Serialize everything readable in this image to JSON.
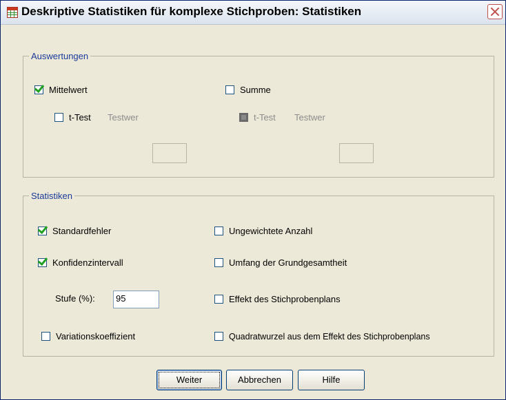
{
  "window": {
    "title": "Deskriptive Statistiken für komplexe Stichproben: Statistiken"
  },
  "auswertungen": {
    "legend": "Auswertungen",
    "mittelwert": {
      "label": "Mittelwert",
      "checked": true
    },
    "mittelwert_ttest": {
      "label": "t-Test",
      "checked": false,
      "testwert_label": "Testwer",
      "testwert_value": ""
    },
    "summe": {
      "label": "Summe",
      "checked": false
    },
    "summe_ttest": {
      "label": "t-Test",
      "checked": false,
      "disabled": true,
      "testwert_label": "Testwer",
      "testwert_value": ""
    }
  },
  "statistiken": {
    "legend": "Statistiken",
    "standardfehler": {
      "label": "Standardfehler",
      "checked": true
    },
    "konfidenzintervall": {
      "label": "Konfidenzintervall",
      "checked": true
    },
    "stufe": {
      "label": "Stufe (%):",
      "value": "95"
    },
    "variationskoeffizient": {
      "label": "Variationskoeffizient",
      "checked": false
    },
    "ungewichtete_anzahl": {
      "label": "Ungewichtete Anzahl",
      "checked": false
    },
    "umfang": {
      "label": "Umfang der Grundgesamtheit",
      "checked": false
    },
    "effekt": {
      "label": "Effekt des Stichprobenplans",
      "checked": false
    },
    "quadratwurzel": {
      "label": "Quadratwurzel aus dem Effekt des Stichprobenplans",
      "checked": false
    }
  },
  "buttons": {
    "weiter": "Weiter",
    "abbrechen": "Abbrechen",
    "hilfe": "Hilfe"
  }
}
